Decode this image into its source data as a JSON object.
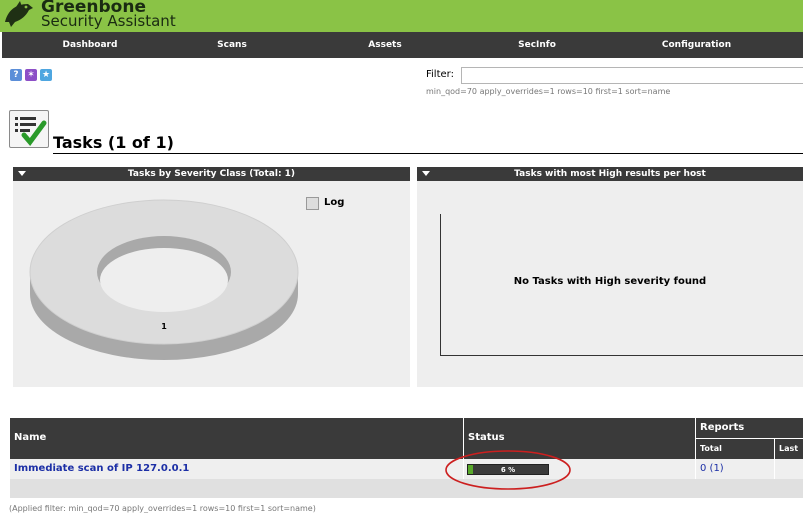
{
  "app": {
    "brand_line1": "Greenbone",
    "brand_line2": "Security Assistant"
  },
  "nav": [
    {
      "label": "Dashboard"
    },
    {
      "label": "Scans"
    },
    {
      "label": "Assets"
    },
    {
      "label": "SecInfo"
    },
    {
      "label": "Configuration"
    }
  ],
  "toolbar": {
    "icons": [
      "help-icon",
      "new-task-wizard-icon",
      "new-task-star-icon"
    ]
  },
  "filter": {
    "label": "Filter:",
    "value": "",
    "applied": "min_qod=70 apply_overrides=1 rows=10 first=1 sort=name"
  },
  "page": {
    "title": "Tasks (1 of 1)"
  },
  "panels": {
    "severity": {
      "title": "Tasks by Severity Class (Total: 1)",
      "legend": "Log",
      "slice_label": "1"
    },
    "high": {
      "title": "Tasks with most High results per host",
      "empty_text": "No Tasks with High severity found"
    }
  },
  "table": {
    "headers": {
      "name": "Name",
      "status": "Status",
      "reports": "Reports",
      "total": "Total",
      "last": "Last"
    },
    "rows": [
      {
        "name": "Immediate scan of IP 127.0.0.1",
        "progress_text": "6 %",
        "progress": 0.06,
        "reports": "0 (1)"
      }
    ]
  },
  "footer": {
    "applied_filter": "(Applied filter: min_qod=70 apply_overrides=1 rows=10 first=1 sort=name)"
  },
  "colors": {
    "header_green": "#8ac346",
    "nav_dark": "#3a3a3a",
    "link_blue": "#1c2fa6",
    "annotation_red": "#cc1f1f"
  }
}
